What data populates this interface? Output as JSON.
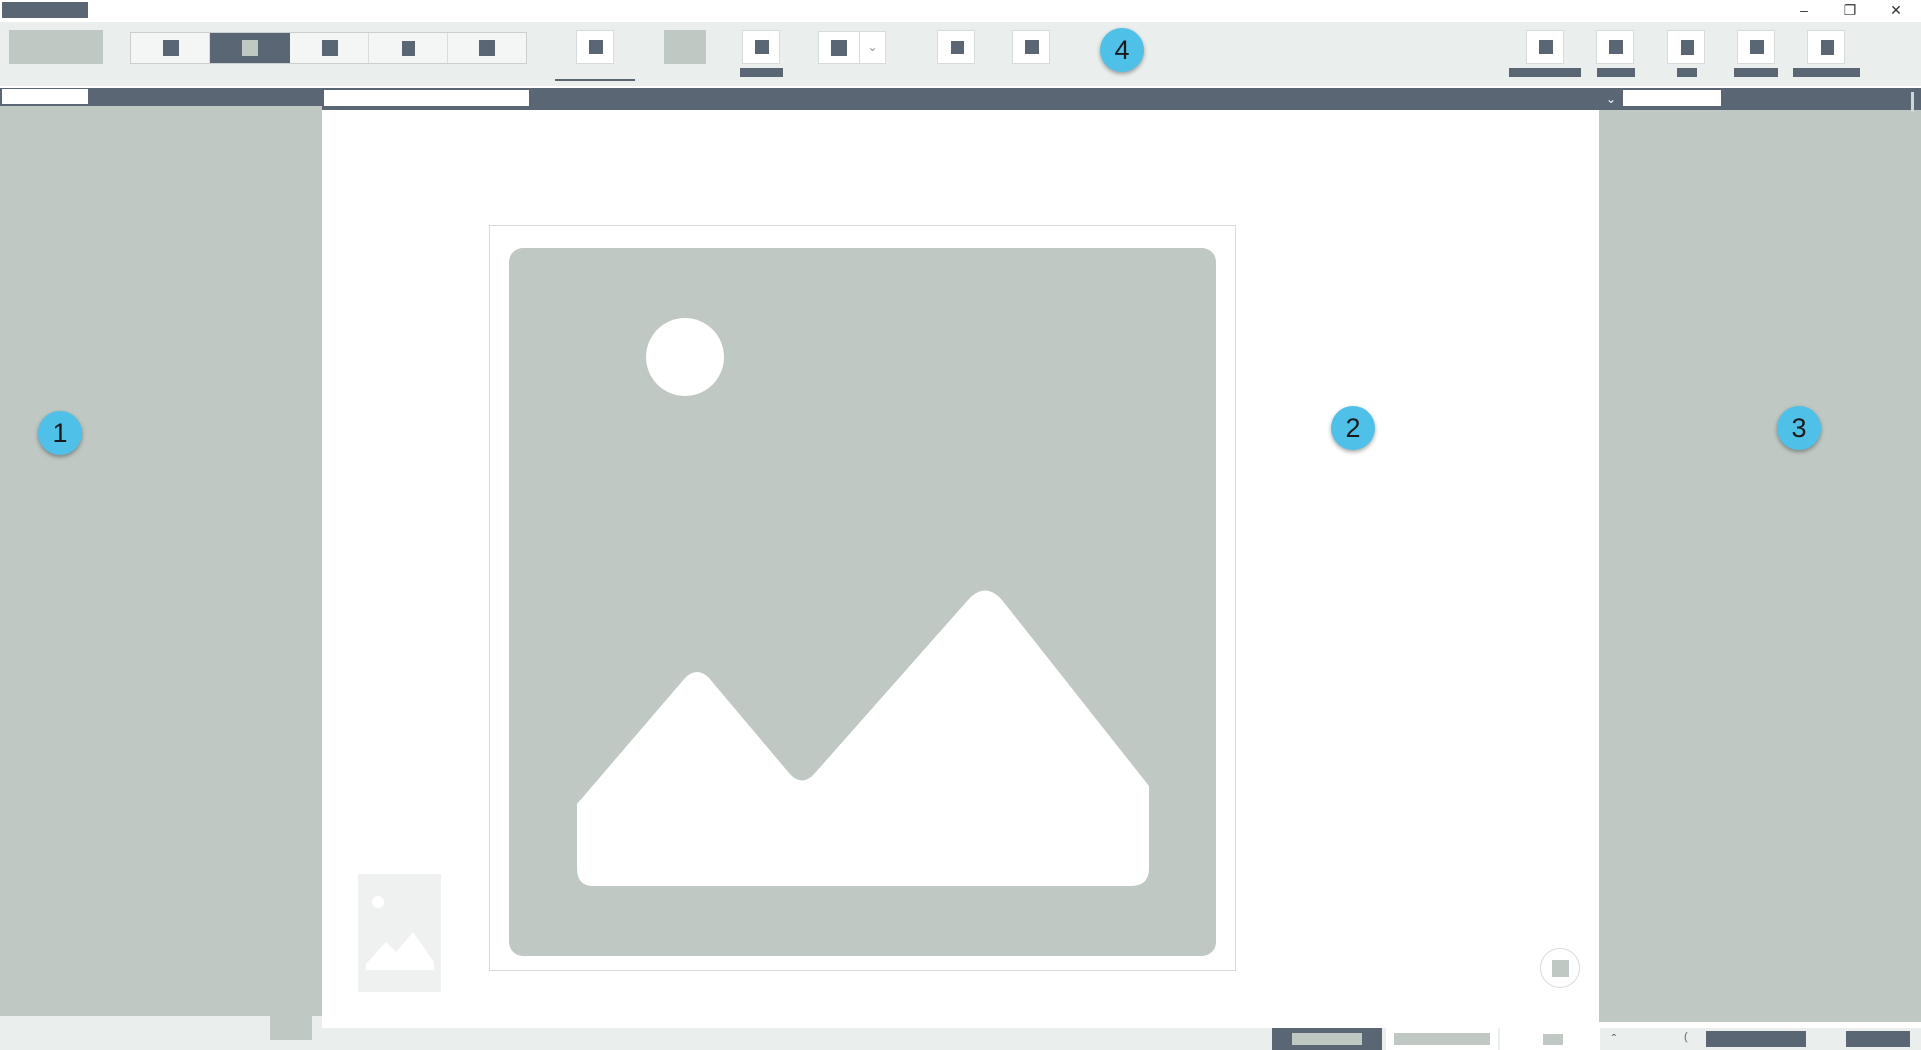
{
  "badges": {
    "left_panel": "1",
    "canvas": "2",
    "right_panel": "3",
    "toolbar": "4"
  },
  "window": {
    "controls": [
      "minimize",
      "restore",
      "close"
    ]
  },
  "toolbar": {
    "segment_selected_index": 1,
    "segment_count": 5,
    "active_tool_index": 0
  },
  "icons": {
    "placeholder_image": "image-placeholder-icon",
    "thumbnail": "thumbnail-image-icon",
    "dropdown": "chevron-down-icon",
    "scroll_up": "chevron-up-icon"
  },
  "colors": {
    "dark_bar": "#5b6675",
    "panel_sage": "#bfc8c2",
    "toolbar_bg": "#eaefee",
    "badge": "#4fc1e8",
    "canvas_bg": "#ffffff"
  }
}
